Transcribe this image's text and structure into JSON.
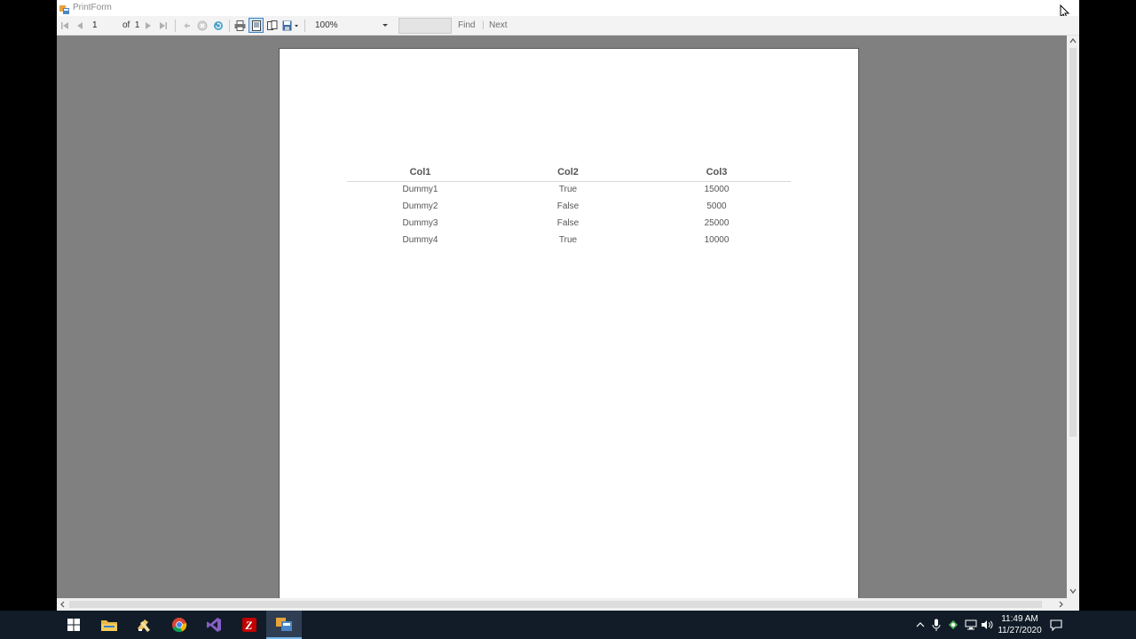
{
  "window": {
    "title": "PrintForm"
  },
  "toolbar": {
    "current_page": "1",
    "of_label": "of",
    "total_pages": "1",
    "zoom_value": "100%",
    "find_label": "Find",
    "separator": "|",
    "next_label": "Next",
    "find_placeholder": ""
  },
  "report": {
    "headers": [
      "Col1",
      "Col2",
      "Col3"
    ],
    "rows": [
      [
        "Dummy1",
        "True",
        "15000"
      ],
      [
        "Dummy2",
        "False",
        "5000"
      ],
      [
        "Dummy3",
        "False",
        "25000"
      ],
      [
        "Dummy4",
        "True",
        "10000"
      ]
    ]
  },
  "taskbar": {
    "apps": [
      "start-icon",
      "file-explorer-icon",
      "visual-studio-installer-icon",
      "chrome-icon",
      "visual-studio-icon",
      "filezilla-icon",
      "printform-app-icon"
    ],
    "time": "11:49 AM",
    "date": "11/27/2020"
  },
  "colors": {
    "viewport_bg": "#808080",
    "taskbar_bg": "#111c28",
    "filezilla_red": "#bf0000",
    "vs_purple": "#865fc5"
  }
}
